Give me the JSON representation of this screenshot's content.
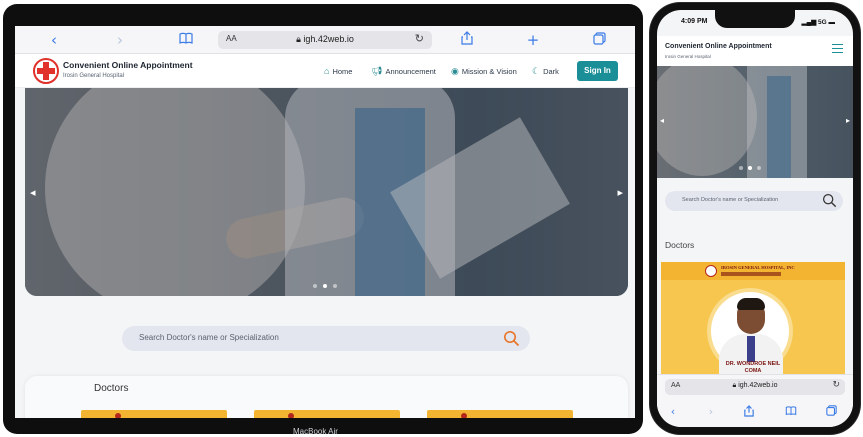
{
  "laptop": {
    "device_label": "MacBook Air",
    "browser": {
      "back_icon": "chevron-left-icon",
      "forward_icon": "chevron-right-icon",
      "reader_icon": "book-icon",
      "text_size_label": "AA",
      "url": "igh.42web.io",
      "lock_icon": "lock-icon",
      "reload_icon": "reload-icon",
      "share_icon": "share-icon",
      "new_tab_icon": "plus-icon",
      "tabs_icon": "tabs-icon"
    },
    "site": {
      "brand_title": "Convenient Online Appointment",
      "brand_subtitle": "Irosin General Hospital",
      "nav": [
        {
          "label": "Home",
          "icon": "home-icon"
        },
        {
          "label": "Announcement",
          "icon": "megaphone-icon"
        },
        {
          "label": "Mission & Vision",
          "icon": "eye-icon"
        },
        {
          "label": "Dark",
          "icon": "moon-icon"
        }
      ],
      "signin_label": "Sign In",
      "search_placeholder": "Search Doctor's name or Specialization",
      "doctors_heading": "Doctors",
      "hero_slides": 3,
      "hero_active_slide": 2
    }
  },
  "phone": {
    "status_time": "4:09 PM",
    "status_right": "5G",
    "site": {
      "brand_title": "Convenient Online Appointment",
      "brand_subtitle": "Irosin General Hospital",
      "search_placeholder": "Search Doctor's name or Specialization",
      "doctors_heading": "Doctors",
      "doctor_card": {
        "hospital": "IROSIN GENERAL HOSPITAL, INC",
        "name_line1": "DR. WONDROE NEIL",
        "name_line2": "COMA"
      }
    },
    "browser": {
      "text_size_label": "AA",
      "url": "igh.42web.io"
    }
  },
  "colors": {
    "accent": "#1b8f98",
    "browser_blue": "#3b7be6",
    "search_icon": "#e8752a",
    "card_yellow": "#f3b531"
  }
}
